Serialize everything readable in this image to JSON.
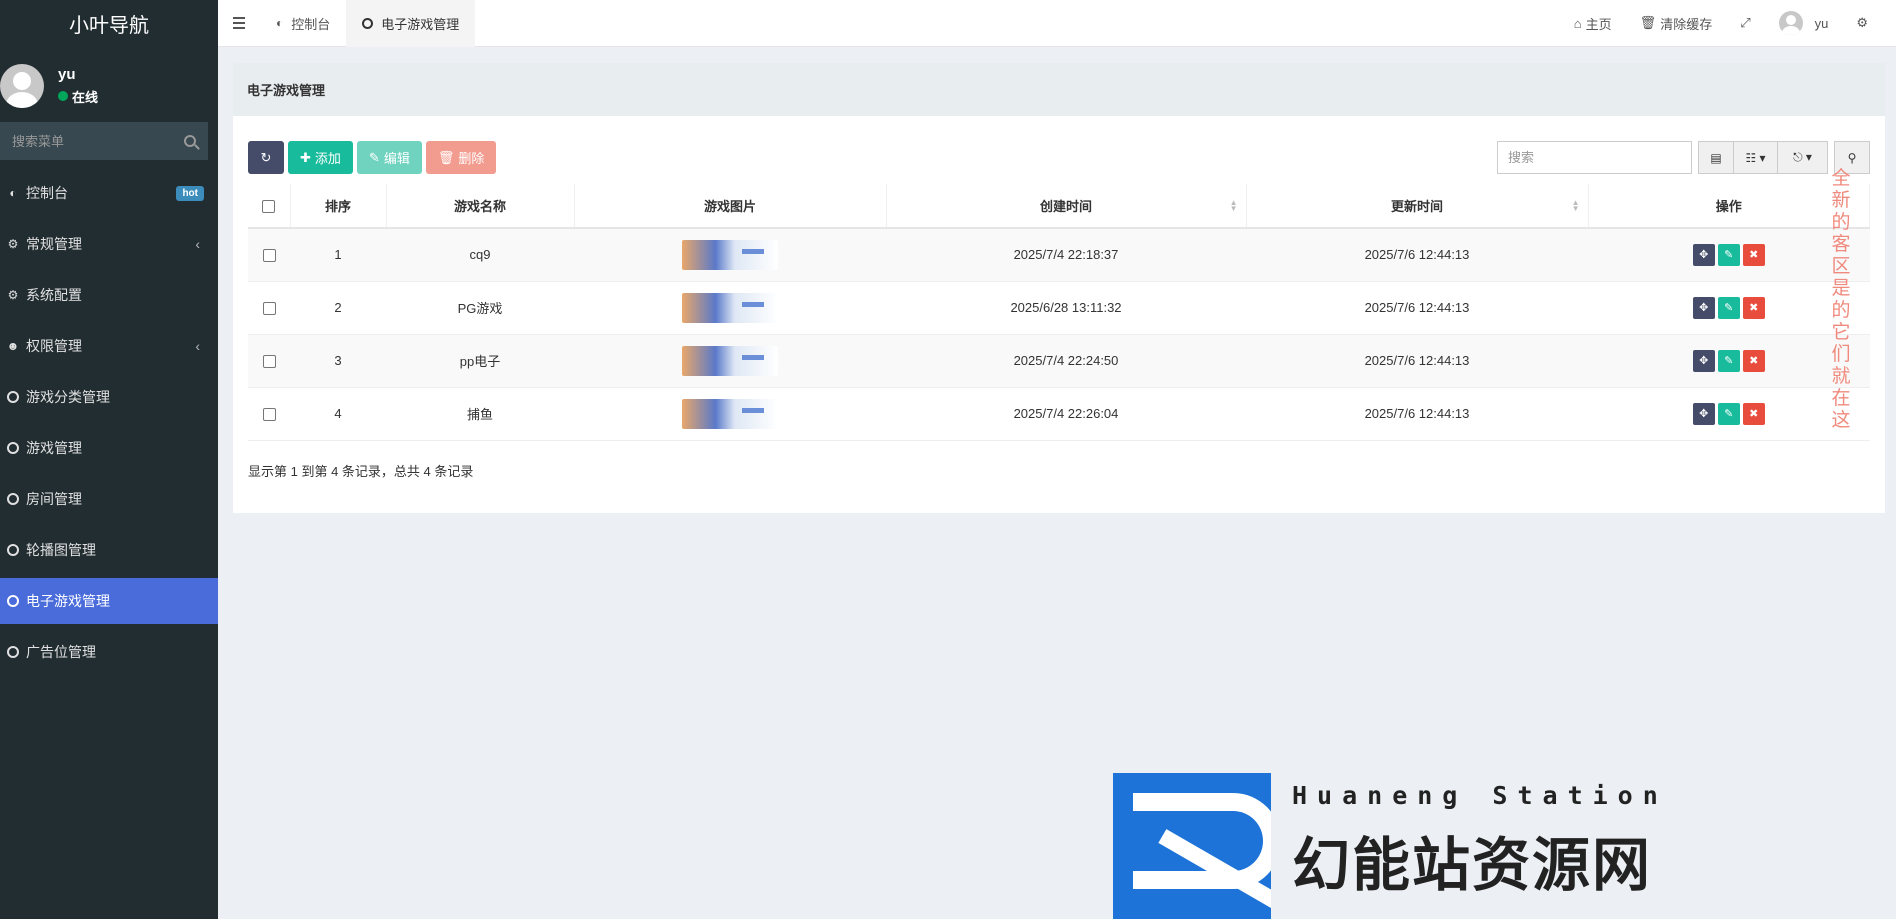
{
  "sidebar": {
    "brand": "小叶导航",
    "user": {
      "name": "yu",
      "status": "在线"
    },
    "search_placeholder": "搜索菜单",
    "items": [
      {
        "label": "控制台",
        "icon": "dashboard-icon",
        "badge": "hot"
      },
      {
        "label": "常规管理",
        "icon": "cogs-icon",
        "has_children": true
      },
      {
        "label": "系统配置",
        "icon": "gear-icon"
      },
      {
        "label": "权限管理",
        "icon": "group-icon",
        "has_children": true
      },
      {
        "label": "游戏分类管理",
        "icon": "circle-icon"
      },
      {
        "label": "游戏管理",
        "icon": "circle-icon"
      },
      {
        "label": "房间管理",
        "icon": "circle-icon"
      },
      {
        "label": "轮播图管理",
        "icon": "circle-icon"
      },
      {
        "label": "电子游戏管理",
        "icon": "circle-icon",
        "active": true
      },
      {
        "label": "广告位管理",
        "icon": "circle-icon"
      }
    ]
  },
  "topbar": {
    "tabs": [
      {
        "label": "控制台",
        "icon": "dashboard-icon"
      },
      {
        "label": "电子游戏管理",
        "icon": "circle-icon",
        "active": true
      }
    ],
    "home": "主页",
    "clear_cache": "清除缓存",
    "user": "yu"
  },
  "panel": {
    "title": "电子游戏管理",
    "buttons": {
      "add": "添加",
      "edit": "编辑",
      "delete": "删除"
    },
    "search_placeholder": "搜索",
    "columns": [
      "排序",
      "游戏名称",
      "游戏图片",
      "创建时间",
      "更新时间",
      "操作"
    ],
    "rows": [
      {
        "sort": "1",
        "name": "cq9",
        "created": "2025/7/4 22:18:37",
        "updated": "2025/7/6 12:44:13"
      },
      {
        "sort": "2",
        "name": "PG游戏",
        "created": "2025/6/28 13:11:32",
        "updated": "2025/7/6 12:44:13"
      },
      {
        "sort": "3",
        "name": "pp电子",
        "created": "2025/7/4 22:24:50",
        "updated": "2025/7/6 12:44:13"
      },
      {
        "sort": "4",
        "name": "捕鱼",
        "created": "2025/7/4 22:26:04",
        "updated": "2025/7/6 12:44:13"
      }
    ],
    "footer": "显示第 1 到第 4 条记录，总共 4 条记录"
  },
  "side_note": "全新的客区 是的 它们就在这",
  "watermark": {
    "subtitle": "Huaneng Station",
    "title": "幻能站资源网"
  }
}
